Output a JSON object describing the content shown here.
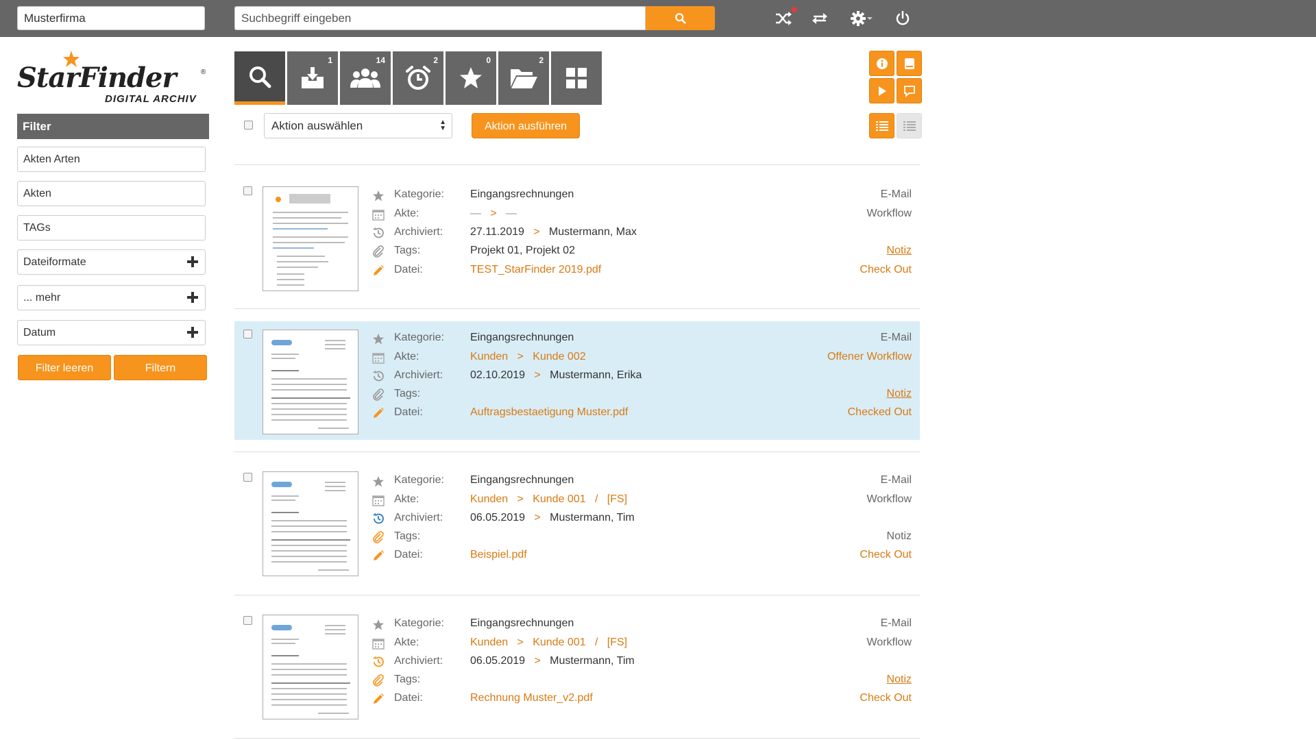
{
  "topbar": {
    "company_value": "Musterfirma",
    "search_placeholder": "Suchbegriff eingeben",
    "icons": [
      "shuffle-icon",
      "transfer-icon",
      "gear-icon",
      "power-icon"
    ]
  },
  "logo": {
    "name": "StarFinder",
    "tagline": "DIGITAL ARCHIV"
  },
  "filter": {
    "header": "Filter",
    "items": [
      {
        "label": "Akten Arten",
        "expandable": false
      },
      {
        "label": "Akten",
        "expandable": false
      },
      {
        "label": "TAGs",
        "expandable": false
      },
      {
        "label": "Dateiformate",
        "expandable": true
      },
      {
        "label": "... mehr",
        "expandable": true
      },
      {
        "label": "Datum",
        "expandable": true
      }
    ],
    "clear_label": "Filter leeren",
    "apply_label": "Filtern"
  },
  "tabs": [
    {
      "icon": "search-icon",
      "count": ""
    },
    {
      "icon": "inbox-icon",
      "count": "1"
    },
    {
      "icon": "users-icon",
      "count": "14"
    },
    {
      "icon": "alarm-icon",
      "count": "2"
    },
    {
      "icon": "star-icon",
      "count": "0"
    },
    {
      "icon": "folder-icon",
      "count": "2"
    },
    {
      "icon": "grid-icon",
      "count": ""
    }
  ],
  "toolbar": {
    "action_select": "Aktion auswählen",
    "action_button": "Aktion ausführen"
  },
  "labels": {
    "kategorie": "Kategorie:",
    "akte": "Akte:",
    "archiviert": "Archiviert:",
    "tags": "Tags:",
    "datei": "Datei:",
    "email": "E-Mail",
    "notiz": "Notiz"
  },
  "records": [
    {
      "kategorie": "Eingangsrechnungen",
      "akte": [
        "—",
        ">",
        "—"
      ],
      "date": "27.11.2019",
      "user": "Mustermann, Max",
      "tags": "Projekt 01, Projekt 02",
      "datei": "TEST_StarFinder 2019.pdf",
      "workflow": "Workflow",
      "checkout": "Check Out"
    },
    {
      "kategorie": "Eingangsrechnungen",
      "akte": [
        "Kunden",
        ">",
        "Kunde 002"
      ],
      "date": "02.10.2019",
      "user": "Mustermann, Erika",
      "tags": "",
      "datei": "Auftragsbestaetigung Muster.pdf",
      "workflow": "Offener Workflow",
      "checkout": "Checked Out"
    },
    {
      "kategorie": "Eingangsrechnungen",
      "akte": [
        "Kunden",
        ">",
        "Kunde 001",
        "/",
        "[FS]"
      ],
      "date": "06.05.2019",
      "user": "Mustermann, Tim",
      "tags": "",
      "datei": "Beispiel.pdf",
      "workflow": "Workflow",
      "checkout": "Check Out"
    },
    {
      "kategorie": "Eingangsrechnungen",
      "akte": [
        "Kunden",
        ">",
        "Kunde 001",
        "/",
        "[FS]"
      ],
      "date": "06.05.2019",
      "user": "Mustermann, Tim",
      "tags": "",
      "datei": "Rechnung Muster_v2.pdf",
      "workflow": "Workflow",
      "checkout": "Check Out"
    }
  ],
  "arrow": ">"
}
